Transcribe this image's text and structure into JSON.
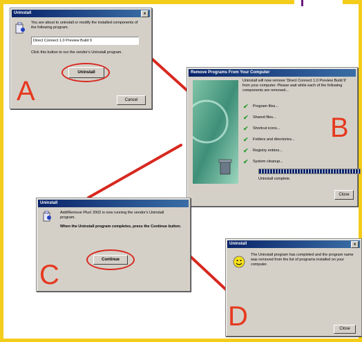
{
  "colors": {
    "accent_red": "#e6391f",
    "title_blue": "#0a246a",
    "dialog_gray": "#d4d0c8",
    "check_green": "#2e9c2e",
    "border_yellow": "#f4cd1c"
  },
  "step_letters": {
    "a": "A",
    "b": "B",
    "c": "C",
    "d": "D"
  },
  "dialog_a": {
    "title": "Uninstall",
    "close_glyph": "x",
    "message": "You are about to uninstall or modify the installed components of the following program.",
    "program_name": "Direct Connect 1.0 Preview Build 9",
    "instruction": "Click this button to run the vendor's Uninstall program.",
    "uninstall_button": "Uninstall",
    "cancel_button": "Cancel"
  },
  "dialog_b": {
    "title": "Remove Programs From Your Computer",
    "message": "Uninstall will now remove 'Direct Connect 1.0 Preview Build 9' from your computer. Please wait while each of the following components are removed...",
    "items": [
      "Program files...",
      "Shared files...",
      "Shortcut icons...",
      "Folders and directories...",
      "Registry entries...",
      "System cleanup..."
    ],
    "progress": 1.0,
    "status": "Uninstall complete.",
    "close_button": "Close"
  },
  "dialog_c": {
    "title": "Uninstall",
    "message": "Add/Remove Plus! 2002 is now running the vendor's Uninstall program.",
    "bold_message": "When the Uninstall program completes, press the Continue button.",
    "continue_button": "Continue"
  },
  "dialog_d": {
    "title": "Uninstall",
    "close_glyph": "x",
    "message": "The Uninstall program has completed and the program name was removed from the list of programs installed on your computer.",
    "close_button": "Close"
  }
}
